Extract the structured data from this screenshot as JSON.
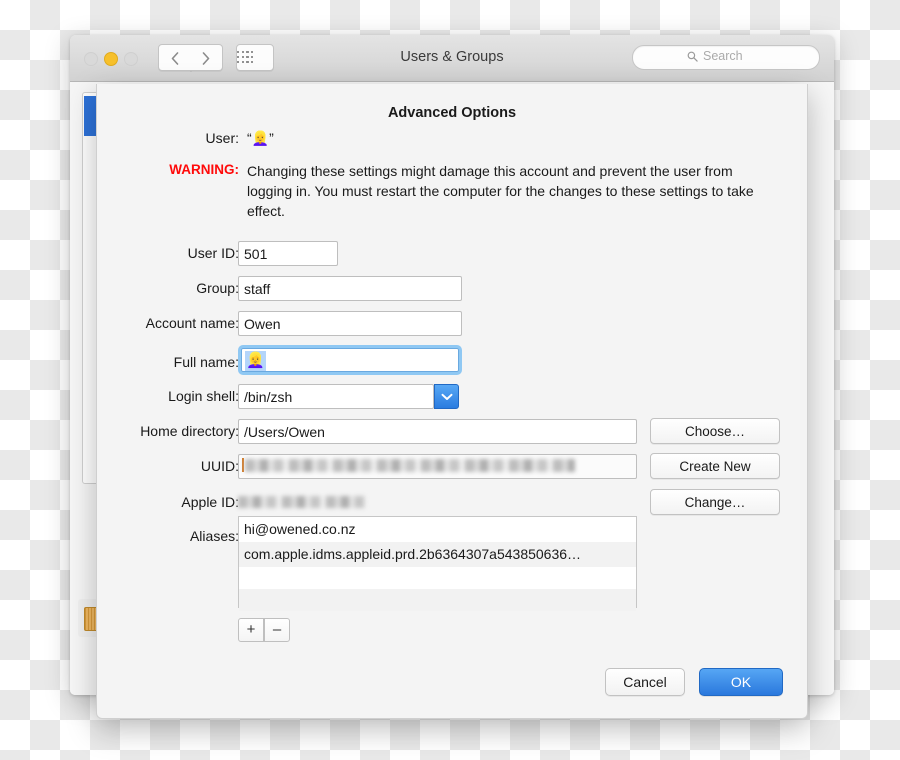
{
  "window": {
    "title": "Users & Groups",
    "traffic_lights": [
      "close",
      "minimize",
      "zoom"
    ],
    "nav": {
      "back": "‹",
      "forward": "›"
    },
    "search": {
      "placeholder": "Search"
    }
  },
  "sheet": {
    "title": "Advanced Options",
    "user": {
      "label": "User:",
      "value": "“👱‍♀️”"
    },
    "warning": {
      "label": "WARNING:",
      "color": "#ff0a0a",
      "text": "Changing these settings might damage this account and prevent the user from logging in. You must restart the computer for the changes to these settings to take effect."
    },
    "fields": {
      "user_id": {
        "label": "User ID:",
        "value": "501"
      },
      "group": {
        "label": "Group:",
        "value": "staff"
      },
      "account_name": {
        "label": "Account name:",
        "value": "Owen"
      },
      "full_name": {
        "label": "Full name:",
        "value": "👱‍♀️",
        "focused": true
      },
      "login_shell": {
        "label": "Login shell:",
        "value": "/bin/zsh"
      },
      "home_directory": {
        "label": "Home directory:",
        "value": "/Users/Owen"
      },
      "uuid": {
        "label": "UUID:",
        "value": ""
      },
      "apple_id": {
        "label": "Apple ID:",
        "value": ""
      },
      "aliases": {
        "label": "Aliases:"
      }
    },
    "side_buttons": {
      "choose": "Choose…",
      "create_new": "Create New",
      "change": "Change…"
    },
    "aliases_list": [
      "hi@owened.co.nz",
      "com.apple.idms.appleid.prd.2b6364307a543850636…"
    ],
    "alias_controls": {
      "add": "+",
      "remove": "–"
    },
    "buttons": {
      "cancel": "Cancel",
      "ok": "OK"
    }
  },
  "colors": {
    "accent_blue": "#2a78dd",
    "warning_red": "#ff0a0a",
    "minimize_yellow": "#f7c02b",
    "focus_ring": "#8fc8f3"
  }
}
